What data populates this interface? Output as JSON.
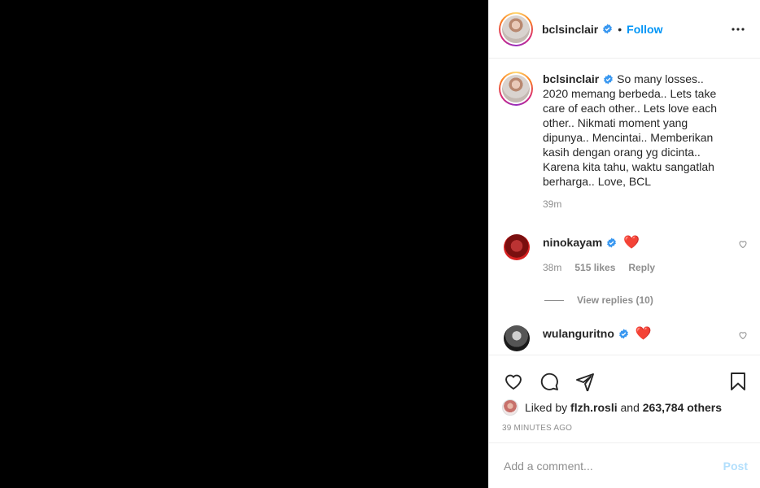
{
  "header": {
    "username": "bclsinclair",
    "separator": "•",
    "follow_label": "Follow"
  },
  "caption": {
    "username": "bclsinclair",
    "text": "So many losses.. 2020 memang berbeda.. Lets take care of each other.. Lets love each other.. Nikmati moment yang dipunya.. Mencintai.. Memberikan kasih dengan orang yg dicinta.. Karena kita tahu, waktu sangatlah berharga.. Love, BCL",
    "time": "39m"
  },
  "comments": [
    {
      "username": "ninokayam",
      "text": "❤️",
      "time": "38m",
      "likes": "515 likes",
      "reply_label": "Reply",
      "view_replies": "View replies (10)"
    },
    {
      "username": "wulanguritno",
      "text": "❤️"
    }
  ],
  "likes": {
    "prefix": "Liked by",
    "liker": "flzh.rosli",
    "and": "and",
    "others": "263,784 others"
  },
  "posted_ago": "39 MINUTES AGO",
  "add_comment": {
    "placeholder": "Add a comment...",
    "post_label": "Post"
  },
  "colors": {
    "accent": "#0095f6",
    "post_disabled": "#b2dffc",
    "muted": "#8e8e8e",
    "heart": "#e0182d"
  },
  "icons": [
    "verified-badge-icon",
    "more-options-icon",
    "heart-icon",
    "comment-icon",
    "share-icon",
    "bookmark-icon"
  ]
}
